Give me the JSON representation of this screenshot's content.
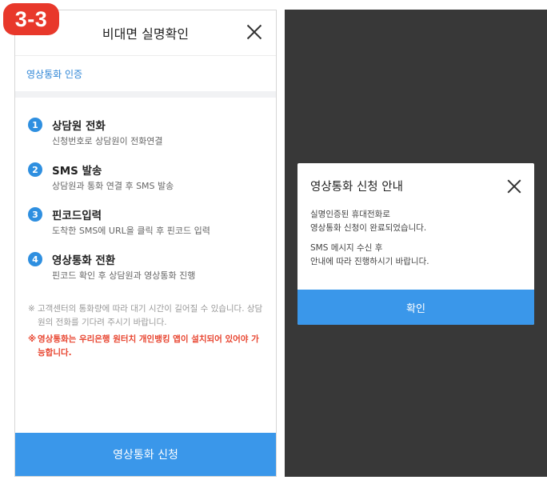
{
  "badge": "3-3",
  "left": {
    "title": "비대면 실명확인",
    "section": "영상통화 인증",
    "steps": [
      {
        "num": "1",
        "title": "상담원 전화",
        "desc": "신청번호로 상담원이 전화연결"
      },
      {
        "num": "2",
        "title": "SMS 발송",
        "desc": "상담원과 통화 연결 후 SMS 발송"
      },
      {
        "num": "3",
        "title": "핀코드입력",
        "desc": "도착한 SMS에 URL을 클릭 후 핀코드 입력"
      },
      {
        "num": "4",
        "title": "영상통화 전환",
        "desc": "핀코드 확인 후 상담원과 영상통화 진행"
      }
    ],
    "notes": {
      "mark": "※",
      "info": "고객센터의 통화량에 따라 대기 시간이 길어질 수 있습니다. 상담원의 전화를 기다려 주시기 바랍니다.",
      "warning": "영상통화는 우리은행 원터치 개인뱅킹 앱이 설치되어 있어야 가능합니다."
    },
    "cta": "영상통화 신청"
  },
  "dialog": {
    "title": "영상통화 신청 안내",
    "line1": "실명인증된 휴대전화로",
    "line2": "영상통화 신청이 완료되었습니다.",
    "line3": "SMS 메시지 수신 후",
    "line4": "안내에 따라 진행하시기 바랍니다.",
    "confirm": "확인"
  },
  "colors": {
    "accent": "#3a97ea",
    "badge": "#e8382b",
    "warning": "#e8442f",
    "overlay": "#383838"
  }
}
